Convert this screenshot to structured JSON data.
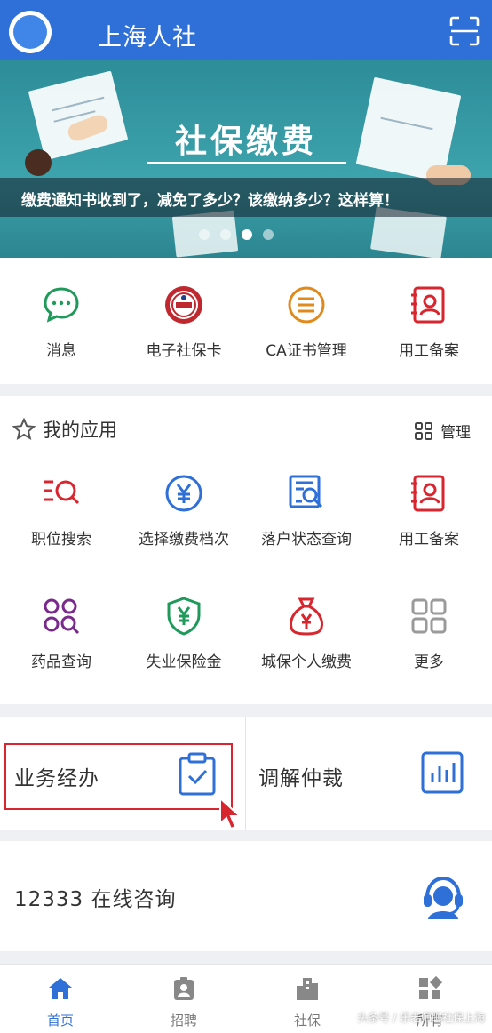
{
  "header": {
    "title": "上海人社"
  },
  "banner": {
    "title": "社保缴费",
    "caption": "缴费通知书收到了，减免了多少？该缴纳多少？这样算！",
    "page_count": 4,
    "active_page": 2
  },
  "quick_actions": [
    {
      "label": "消息",
      "icon": "chat-bubble-icon",
      "color": "#1f9a5a"
    },
    {
      "label": "电子社保卡",
      "icon": "social-security-badge-icon",
      "color": "#c0282f"
    },
    {
      "label": "CA证书管理",
      "icon": "certificate-list-icon",
      "color": "#e08a1e"
    },
    {
      "label": "用工备案",
      "icon": "employment-record-icon",
      "color": "#d8262f"
    }
  ],
  "my_apps": {
    "title": "我的应用",
    "manage_label": "管理",
    "items": [
      {
        "label": "职位搜索",
        "icon": "job-search-icon",
        "color": "#d8262f"
      },
      {
        "label": "选择缴费档次",
        "icon": "yuan-circle-icon",
        "color": "#2f6fd8"
      },
      {
        "label": "落户状态查询",
        "icon": "document-search-icon",
        "color": "#2f6fd8"
      },
      {
        "label": "用工备案",
        "icon": "employment-record-icon",
        "color": "#d8262f"
      },
      {
        "label": "药品查询",
        "icon": "medicine-search-icon",
        "color": "#7a2a8c"
      },
      {
        "label": "失业保险金",
        "icon": "yuan-shield-icon",
        "color": "#1f9a5a"
      },
      {
        "label": "城保个人缴费",
        "icon": "money-bag-icon",
        "color": "#d8262f"
      },
      {
        "label": "更多",
        "icon": "more-grid-icon",
        "color": "#888888"
      }
    ]
  },
  "services": {
    "business": "业务经办",
    "mediation": "调解仲裁"
  },
  "consult": {
    "label": "12333 在线咨询"
  },
  "bottom_nav": [
    {
      "label": "首页",
      "icon": "home-icon",
      "active": true
    },
    {
      "label": "招聘",
      "icon": "recruit-badge-icon",
      "active": false
    },
    {
      "label": "社保",
      "icon": "building-icon",
      "active": false
    },
    {
      "label": "所有",
      "icon": "all-apps-icon",
      "active": false
    }
  ],
  "watermark": "头条号 / 乐老师聊社保上海"
}
